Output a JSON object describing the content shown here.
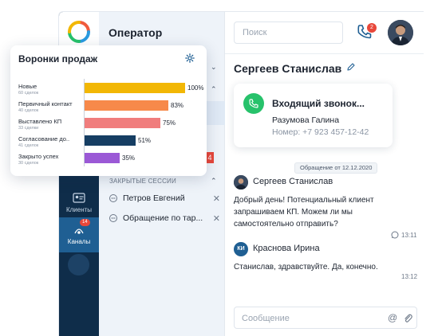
{
  "app": {
    "title": "Оператор"
  },
  "rail": {
    "items": [
      {
        "label": "Клиенты",
        "icon": "id-card-icon",
        "active": false,
        "badge": ""
      },
      {
        "label": "Каналы",
        "icon": "channels-icon",
        "active": true,
        "badge": "14"
      }
    ]
  },
  "list": {
    "red_tab": "4",
    "closed_sessions_label": "ЗАКРЫТЫЕ СЕССИИ",
    "closed_sessions": [
      {
        "name": "Петров Евгений"
      },
      {
        "name": "Обращение по тар..."
      }
    ]
  },
  "header": {
    "search_placeholder": "Поиск",
    "calls_badge": "2",
    "accent": "#1f5f93"
  },
  "contact": {
    "name": "Сергеев Станислав"
  },
  "incoming_call": {
    "title": "Входящий звонок...",
    "person": "Разумова Галина",
    "number": "Номер: +7 923 457-12-42",
    "color": "#27c26b"
  },
  "chat": {
    "date_chip": "Обращение от 12.12.2020",
    "messages": [
      {
        "author": "Сергеев Станислав",
        "text": "Добрый день! Потенциальный клиент запрашиваем КП. Можем ли мы самостоятельно отправить?",
        "time": "13:11",
        "channel_icon": "whatsapp-icon"
      },
      {
        "author": "Краснова Ирина",
        "initials": "КИ",
        "text": "Станислав, здравствуйте. Да, конечно.",
        "time": "13:12"
      }
    ]
  },
  "compose": {
    "placeholder": "Сообщение"
  },
  "funnel": {
    "title": "Воронки продаж",
    "stages": [
      {
        "name": "Новые",
        "sub": "60 сделок",
        "percent": 100,
        "pct_label": "100%",
        "color": "#f2b705"
      },
      {
        "name": "Первичный контакт",
        "sub": "40 сделок",
        "percent": 83,
        "pct_label": "83%",
        "color": "#f7894a"
      },
      {
        "name": "Выставлено КП",
        "sub": "33 сделки",
        "percent": 75,
        "pct_label": "75%",
        "color": "#f07d7d"
      },
      {
        "name": "Согласование до..",
        "sub": "41 сделок",
        "percent": 51,
        "pct_label": "51%",
        "color": "#163e63"
      },
      {
        "name": "Закрыто успех",
        "sub": "30 сделок",
        "percent": 35,
        "pct_label": "35%",
        "color": "#9b59d6"
      }
    ]
  }
}
